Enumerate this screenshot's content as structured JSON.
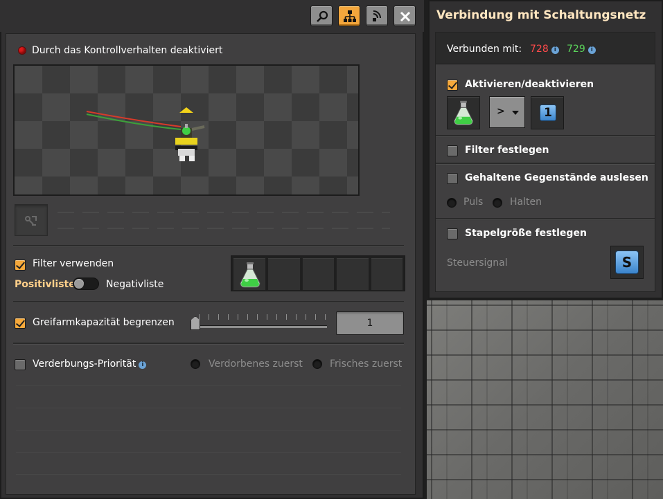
{
  "left_panel": {
    "toolbar": {
      "search_icon": "magnifier-icon",
      "network_icon": "circuit-network-icon",
      "signal_icon": "logistic-network-icon",
      "close_icon": "close-icon"
    },
    "status_text": "Durch das Kontrollverhalten deaktiviert",
    "filter": {
      "label": "Filter verwenden",
      "whitelist": "Positivliste",
      "blacklist": "Negativliste",
      "checked": true
    },
    "capacity": {
      "label": "Greifarmkapazität begrenzen",
      "value": "1",
      "checked": true
    },
    "spoil": {
      "label": "Verderbungs-Priorität",
      "option_a": "Verdorbenes zuerst",
      "option_b": "Frisches zuerst",
      "checked": false
    }
  },
  "right_panel": {
    "title": "Verbindung mit Schaltungsnetz",
    "connected_label": "Verbunden mit:",
    "red_network": "728",
    "green_network": "729",
    "enable": {
      "label": "Aktivieren/deaktivieren",
      "operator": ">",
      "constant": "1",
      "checked": true
    },
    "set_filters": {
      "label": "Filter festlegen",
      "checked": false
    },
    "read_contents": {
      "label": "Gehaltene Gegenstände auslesen",
      "pulse": "Puls",
      "hold": "Halten",
      "checked": false
    },
    "stack_size": {
      "label": "Stapelgröße festlegen",
      "signal_label": "Steuersignal",
      "signal": "S",
      "checked": false
    }
  },
  "colors": {
    "accent_orange": "#f6a93b",
    "red_wire": "#ff4a4a",
    "green_wire": "#5bd45b",
    "panel": "#403f40"
  }
}
